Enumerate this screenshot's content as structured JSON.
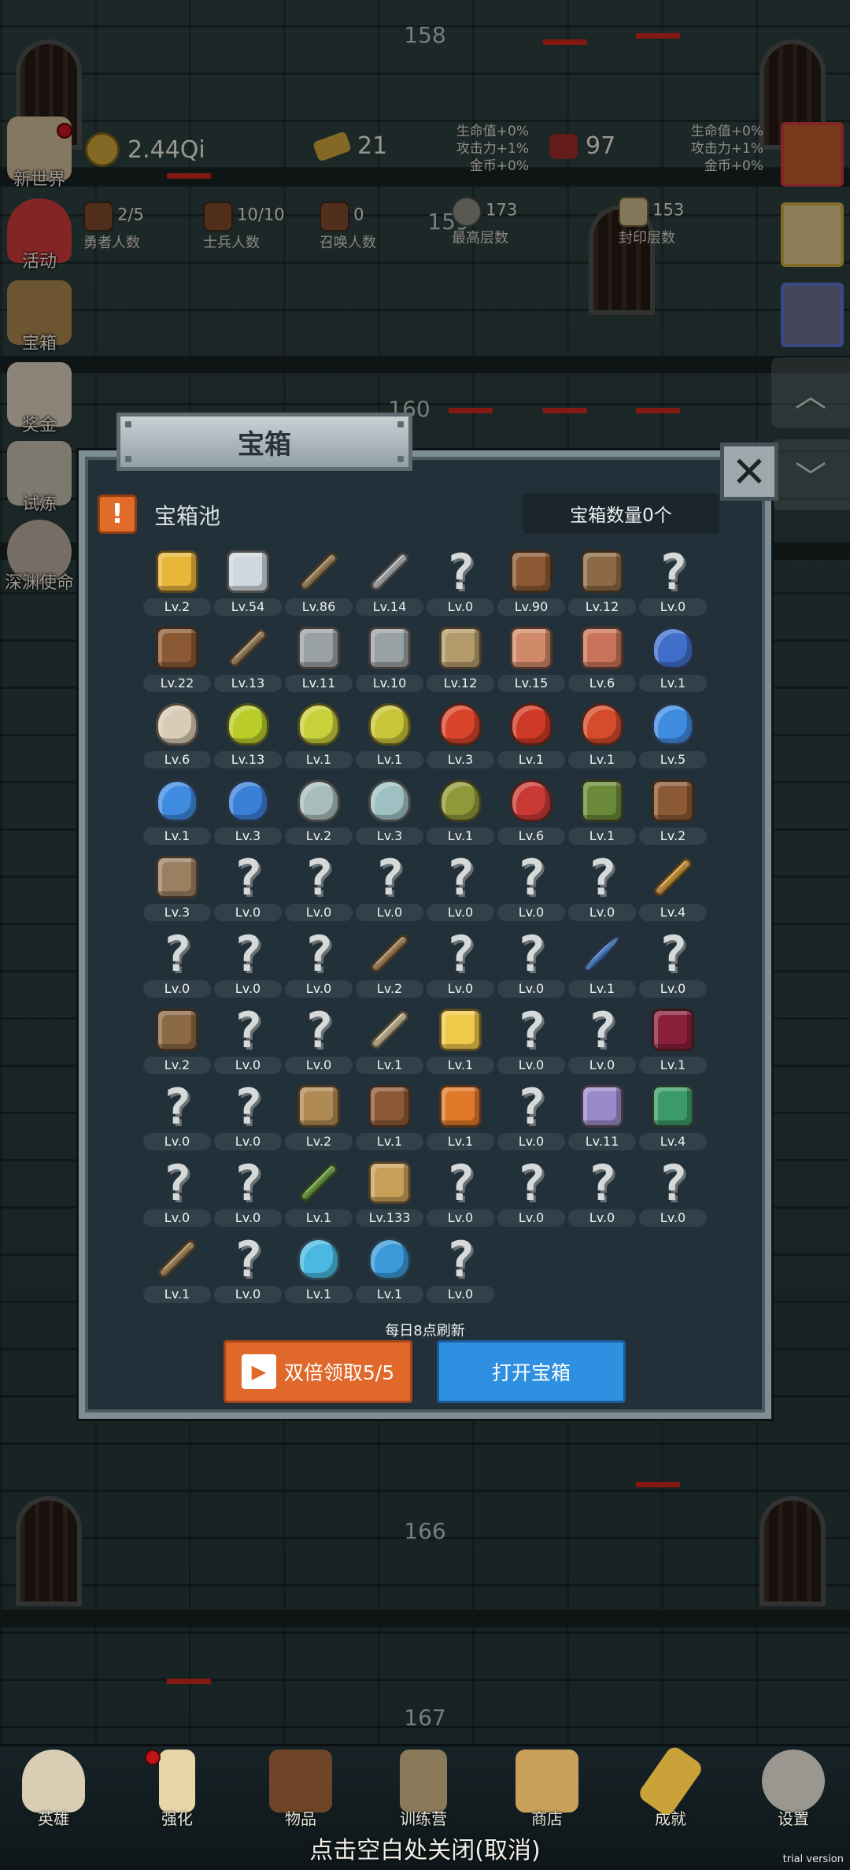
{
  "floors": [
    "158",
    "159",
    "160",
    "166",
    "167"
  ],
  "hud": {
    "gold": "2.44Qi",
    "bars": "21",
    "gems": "97",
    "bonus_left": [
      "生命值+0%",
      "攻击力+1%",
      "金币+0%"
    ],
    "bonus_right": [
      "生命值+0%",
      "攻击力+1%",
      "金币+0%"
    ],
    "stats": [
      {
        "value": "2/5",
        "label": "勇者人数"
      },
      {
        "value": "10/10",
        "label": "士兵人数"
      },
      {
        "value": "0",
        "label": "召唤人数"
      },
      {
        "value": "173",
        "label": "最高层数"
      },
      {
        "value": "153",
        "label": "封印层数"
      }
    ]
  },
  "side_menu": [
    "新世界",
    "活动",
    "宝箱",
    "奖金",
    "试炼",
    "深渊使命"
  ],
  "modal": {
    "title": "宝箱",
    "close": "✕",
    "pool_label": "宝箱池",
    "chest_count": "宝箱数量0个",
    "refresh_note": "每日8点刷新",
    "double_button": "双倍领取5/5",
    "open_button": "打开宝箱",
    "items": [
      {
        "icon": "crown-icon",
        "color": "#e8b73a",
        "level": "Lv.2"
      },
      {
        "icon": "diamond-icon",
        "color": "#cfd8de",
        "level": "Lv.54"
      },
      {
        "icon": "sword-icon",
        "color": "#a88a5a",
        "level": "Lv.86"
      },
      {
        "icon": "sword-icon",
        "color": "#b9bec2",
        "level": "Lv.14"
      },
      {
        "icon": "unknown-icon",
        "color": "",
        "level": "Lv.0"
      },
      {
        "icon": "leather-armor-icon",
        "color": "#8b5a35",
        "level": "Lv.90"
      },
      {
        "icon": "backpack-icon",
        "color": "#8b6a45",
        "level": "Lv.12"
      },
      {
        "icon": "unknown-icon",
        "color": "",
        "level": "Lv.0"
      },
      {
        "icon": "leather-helmet-icon",
        "color": "#8b5a35",
        "level": "Lv.22"
      },
      {
        "icon": "dagger-icon",
        "color": "#a88a5a",
        "level": "Lv.13"
      },
      {
        "icon": "knight-helmet-icon",
        "color": "#9aa1a5",
        "level": "Lv.11"
      },
      {
        "icon": "hammer-icon",
        "color": "#9aa1a5",
        "level": "Lv.10"
      },
      {
        "icon": "great-helm-icon",
        "color": "#b39a6a",
        "level": "Lv.12"
      },
      {
        "icon": "ham-icon",
        "color": "#d08a6a",
        "level": "Lv.15"
      },
      {
        "icon": "steak-icon",
        "color": "#c9735a",
        "level": "Lv.6"
      },
      {
        "icon": "pouch-icon",
        "color": "#3f6fc9",
        "level": "Lv.1"
      },
      {
        "icon": "flour-bowl-icon",
        "color": "#d9cbb6",
        "level": "Lv.6"
      },
      {
        "icon": "yellow-potion-icon",
        "color": "#b9cc2a",
        "level": "Lv.13"
      },
      {
        "icon": "yellow-potion-icon",
        "color": "#c7d13a",
        "level": "Lv.1"
      },
      {
        "icon": "yellow-potion-icon",
        "color": "#c9c53a",
        "level": "Lv.1"
      },
      {
        "icon": "red-potion-icon",
        "color": "#d8452a",
        "level": "Lv.3"
      },
      {
        "icon": "red-potion-icon",
        "color": "#cf3a26",
        "level": "Lv.1"
      },
      {
        "icon": "red-potion-icon",
        "color": "#d64b2c",
        "level": "Lv.1"
      },
      {
        "icon": "blue-potion-icon",
        "color": "#3f8be0",
        "level": "Lv.5"
      },
      {
        "icon": "blue-potion-icon",
        "color": "#3f8be0",
        "level": "Lv.1"
      },
      {
        "icon": "blue-potion-icon",
        "color": "#3a7fd8",
        "level": "Lv.3"
      },
      {
        "icon": "empty-flask-icon",
        "color": "#a9bcbc",
        "level": "Lv.2"
      },
      {
        "icon": "empty-flask-icon",
        "color": "#9fc0c2",
        "level": "Lv.3"
      },
      {
        "icon": "olive-bottle-icon",
        "color": "#8e9a3a",
        "level": "Lv.1"
      },
      {
        "icon": "red-bottle-icon",
        "color": "#c93a35",
        "level": "Lv.6"
      },
      {
        "icon": "winged-boot-icon",
        "color": "#6a8a3a",
        "level": "Lv.1"
      },
      {
        "icon": "boot-icon",
        "color": "#8b5a35",
        "level": "Lv.2"
      },
      {
        "icon": "shoe-icon",
        "color": "#9a8060",
        "level": "Lv.3"
      },
      {
        "icon": "unknown-icon",
        "color": "",
        "level": "Lv.0"
      },
      {
        "icon": "unknown-icon",
        "color": "",
        "level": "Lv.0"
      },
      {
        "icon": "unknown-icon",
        "color": "",
        "level": "Lv.0"
      },
      {
        "icon": "unknown-icon",
        "color": "",
        "level": "Lv.0"
      },
      {
        "icon": "unknown-icon",
        "color": "",
        "level": "Lv.0"
      },
      {
        "icon": "unknown-icon",
        "color": "",
        "level": "Lv.0"
      },
      {
        "icon": "fire-staff-icon",
        "color": "#e0a030",
        "level": "Lv.4"
      },
      {
        "icon": "unknown-icon",
        "color": "",
        "level": "Lv.0"
      },
      {
        "icon": "unknown-icon",
        "color": "",
        "level": "Lv.0"
      },
      {
        "icon": "unknown-icon",
        "color": "",
        "level": "Lv.0"
      },
      {
        "icon": "crook-staff-icon",
        "color": "#b08a55",
        "level": "Lv.2"
      },
      {
        "icon": "unknown-icon",
        "color": "",
        "level": "Lv.0"
      },
      {
        "icon": "unknown-icon",
        "color": "",
        "level": "Lv.0"
      },
      {
        "icon": "orb-wand-icon",
        "color": "#3f7fd8",
        "level": "Lv.1"
      },
      {
        "icon": "unknown-icon",
        "color": "",
        "level": "Lv.0"
      },
      {
        "icon": "backpack-icon",
        "color": "#8b6a45",
        "level": "Lv.2"
      },
      {
        "icon": "unknown-icon",
        "color": "",
        "level": "Lv.0"
      },
      {
        "icon": "unknown-icon",
        "color": "",
        "level": "Lv.0"
      },
      {
        "icon": "bone-club-icon",
        "color": "#d9c79a",
        "level": "Lv.1"
      },
      {
        "icon": "cheese-icon",
        "color": "#f0c84a",
        "level": "Lv.1"
      },
      {
        "icon": "unknown-icon",
        "color": "",
        "level": "Lv.0"
      },
      {
        "icon": "unknown-icon",
        "color": "",
        "level": "Lv.0"
      },
      {
        "icon": "dark-crystal-icon",
        "color": "#8a1f3a",
        "level": "Lv.1"
      },
      {
        "icon": "unknown-icon",
        "color": "",
        "level": "Lv.0"
      },
      {
        "icon": "unknown-icon",
        "color": "",
        "level": "Lv.0"
      },
      {
        "icon": "bow-icon",
        "color": "#b08a55",
        "level": "Lv.2"
      },
      {
        "icon": "quiver-icon",
        "color": "#8b5a35",
        "level": "Lv.1"
      },
      {
        "icon": "fire-shield-icon",
        "color": "#e07a2a",
        "level": "Lv.1"
      },
      {
        "icon": "unknown-icon",
        "color": "",
        "level": "Lv.0"
      },
      {
        "icon": "gem-cluster-icon",
        "color": "#9a8ac9",
        "level": "Lv.11"
      },
      {
        "icon": "emerald-amulet-icon",
        "color": "#3a9a6a",
        "level": "Lv.4"
      },
      {
        "icon": "unknown-icon",
        "color": "",
        "level": "Lv.0"
      },
      {
        "icon": "unknown-icon",
        "color": "",
        "level": "Lv.0"
      },
      {
        "icon": "green-wand-icon",
        "color": "#6aa83a",
        "level": "Lv.1"
      },
      {
        "icon": "beer-mug-icon",
        "color": "#c9a05a",
        "level": "Lv.133"
      },
      {
        "icon": "unknown-icon",
        "color": "",
        "level": "Lv.0"
      },
      {
        "icon": "unknown-icon",
        "color": "",
        "level": "Lv.0"
      },
      {
        "icon": "unknown-icon",
        "color": "",
        "level": "Lv.0"
      },
      {
        "icon": "unknown-icon",
        "color": "",
        "level": "Lv.0"
      },
      {
        "icon": "whip-icon",
        "color": "#b08a55",
        "level": "Lv.1"
      },
      {
        "icon": "unknown-icon",
        "color": "",
        "level": "Lv.0"
      },
      {
        "icon": "crystal-ball-icon",
        "color": "#4ab8e0",
        "level": "Lv.1"
      },
      {
        "icon": "rune-orb-icon",
        "color": "#3a9ad8",
        "level": "Lv.1"
      },
      {
        "icon": "unknown-icon",
        "color": "",
        "level": "Lv.0"
      }
    ]
  },
  "bottom_nav": [
    "英雄",
    "强化",
    "物品",
    "训练营",
    "商店",
    "成就",
    "设置"
  ],
  "close_hint": "点击空白处关闭(取消)",
  "watermark": "trial version"
}
